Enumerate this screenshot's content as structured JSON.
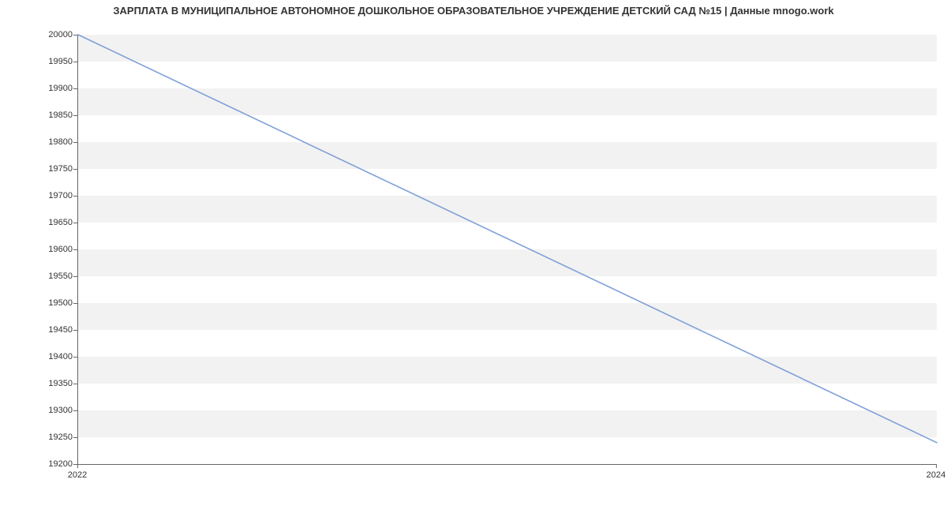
{
  "chart_data": {
    "type": "line",
    "title": "ЗАРПЛАТА В МУНИЦИПАЛЬНОЕ АВТОНОМНОЕ ДОШКОЛЬНОЕ ОБРАЗОВАТЕЛЬНОЕ УЧРЕЖДЕНИЕ ДЕТСКИЙ САД №15 | Данные mnogo.work",
    "xlabel": "",
    "ylabel": "",
    "x": [
      2022,
      2024
    ],
    "y": [
      20000,
      19240
    ],
    "xlim": [
      2022,
      2024
    ],
    "ylim": [
      19200,
      20000
    ],
    "y_ticks": [
      19200,
      19250,
      19300,
      19350,
      19400,
      19450,
      19500,
      19550,
      19600,
      19650,
      19700,
      19750,
      19800,
      19850,
      19900,
      19950,
      20000
    ],
    "x_ticks": [
      2022,
      2024
    ],
    "line_color": "#7e9fd8",
    "band_color": "#f2f2f2"
  }
}
